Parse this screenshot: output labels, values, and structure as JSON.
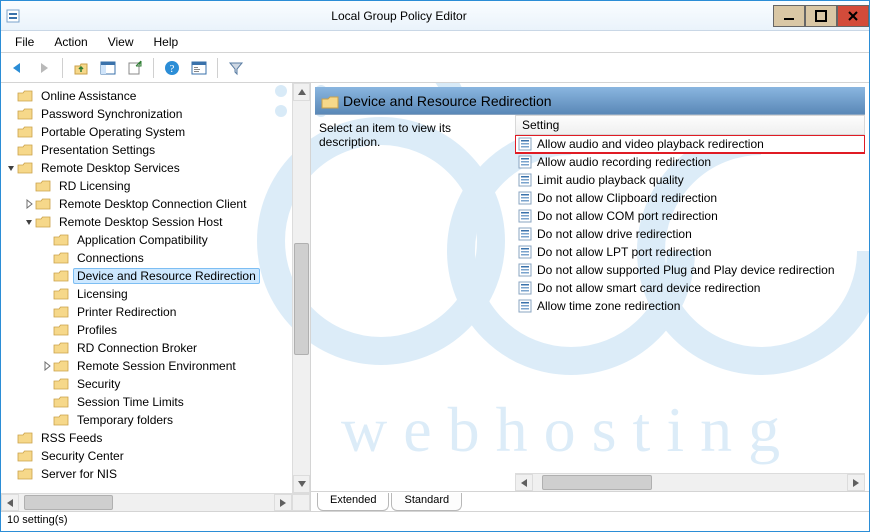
{
  "window": {
    "title": "Local Group Policy Editor"
  },
  "menu": {
    "file": "File",
    "action": "Action",
    "view": "View",
    "help": "Help"
  },
  "toolbar": {
    "back": "back-icon",
    "forward": "forward-icon",
    "up": "up-folder-icon",
    "show": "show-pane-icon",
    "export": "export-icon",
    "help": "help-icon",
    "properties": "properties-icon",
    "filter": "filter-icon"
  },
  "tree": {
    "items": [
      {
        "label": "Online Assistance",
        "indent": 0,
        "expander": "none"
      },
      {
        "label": "Password Synchronization",
        "indent": 0,
        "expander": "none"
      },
      {
        "label": "Portable Operating System",
        "indent": 0,
        "expander": "none"
      },
      {
        "label": "Presentation Settings",
        "indent": 0,
        "expander": "none"
      },
      {
        "label": "Remote Desktop Services",
        "indent": 0,
        "expander": "open"
      },
      {
        "label": "RD Licensing",
        "indent": 1,
        "expander": "none"
      },
      {
        "label": "Remote Desktop Connection Client",
        "indent": 1,
        "expander": "closed"
      },
      {
        "label": "Remote Desktop Session Host",
        "indent": 1,
        "expander": "open"
      },
      {
        "label": "Application Compatibility",
        "indent": 2,
        "expander": "none"
      },
      {
        "label": "Connections",
        "indent": 2,
        "expander": "none"
      },
      {
        "label": "Device and Resource Redirection",
        "indent": 2,
        "expander": "none",
        "selected": true
      },
      {
        "label": "Licensing",
        "indent": 2,
        "expander": "none"
      },
      {
        "label": "Printer Redirection",
        "indent": 2,
        "expander": "none"
      },
      {
        "label": "Profiles",
        "indent": 2,
        "expander": "none"
      },
      {
        "label": "RD Connection Broker",
        "indent": 2,
        "expander": "none"
      },
      {
        "label": "Remote Session Environment",
        "indent": 2,
        "expander": "closed"
      },
      {
        "label": "Security",
        "indent": 2,
        "expander": "none"
      },
      {
        "label": "Session Time Limits",
        "indent": 2,
        "expander": "none"
      },
      {
        "label": "Temporary folders",
        "indent": 2,
        "expander": "none"
      },
      {
        "label": "RSS Feeds",
        "indent": 0,
        "expander": "none"
      },
      {
        "label": "Security Center",
        "indent": 0,
        "expander": "none"
      },
      {
        "label": "Server for NIS",
        "indent": 0,
        "expander": "none"
      }
    ],
    "vscroll": {
      "thumb_top_pct": 38,
      "thumb_height_pct": 30
    },
    "hscroll": {
      "thumb_left_pct": 2,
      "thumb_width_pct": 35
    }
  },
  "right": {
    "header_title": "Device and Resource Redirection",
    "desc_hint": "Select an item to view its description.",
    "col_header": "Setting",
    "settings": [
      {
        "label": "Allow audio and video playback redirection",
        "highlighted": true
      },
      {
        "label": "Allow audio recording redirection"
      },
      {
        "label": "Limit audio playback quality"
      },
      {
        "label": "Do not allow Clipboard redirection"
      },
      {
        "label": "Do not allow COM port redirection"
      },
      {
        "label": "Do not allow drive redirection"
      },
      {
        "label": "Do not allow LPT port redirection"
      },
      {
        "label": "Do not allow supported Plug and Play device redirection"
      },
      {
        "label": "Do not allow smart card device redirection"
      },
      {
        "label": "Allow time zone redirection"
      }
    ],
    "hscroll": {
      "thumb_left_pct": 3,
      "thumb_width_pct": 35
    }
  },
  "tabs": {
    "extended": "Extended",
    "standard": "Standard",
    "active": "extended"
  },
  "statusbar": {
    "text": "10 setting(s)"
  }
}
